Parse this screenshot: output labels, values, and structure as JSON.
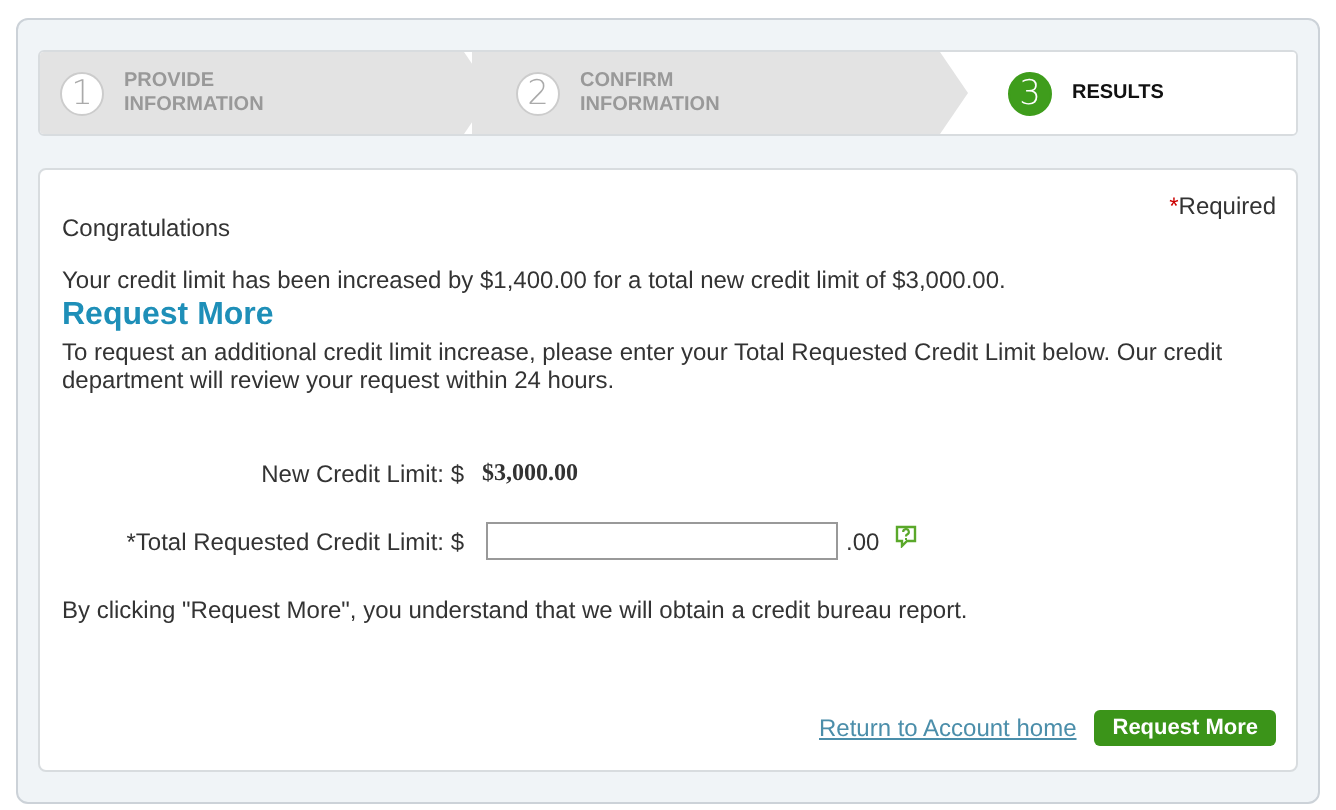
{
  "steps": [
    {
      "number": "1",
      "label": "PROVIDE\nINFORMATION",
      "selected": false
    },
    {
      "number": "2",
      "label": "CONFIRM\nINFORMATION",
      "selected": false
    },
    {
      "number": "3",
      "label": "RESULTS",
      "selected": true
    }
  ],
  "required": {
    "mark": "*",
    "label": "Required"
  },
  "greeting": "Congratulations",
  "message": "Your credit limit has been increased by $1,400.00 for a total new credit limit of $3,000.00.",
  "section_title": "Request More",
  "instructions": "To request an additional credit limit increase, please enter your Total Requested Credit Limit below. Our credit department will review your request within 24 hours.",
  "new_limit": {
    "label": "New Credit Limit: $",
    "value": "$3,000.00"
  },
  "requested_limit": {
    "label": "*Total Requested Credit Limit: $",
    "suffix": ".00"
  },
  "disclaimer": "By clicking \"Request More\", you understand that we will obtain a credit bureau report.",
  "return_link": "Return to Account home",
  "submit_button": "Request More"
}
